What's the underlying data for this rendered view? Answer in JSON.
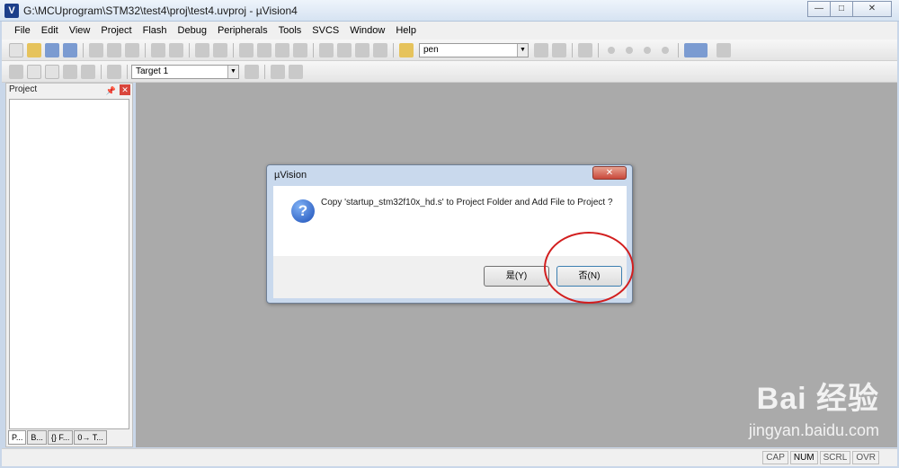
{
  "window": {
    "title": "G:\\MCUprogram\\STM32\\test4\\proj\\test4.uvproj - µVision4"
  },
  "menu": [
    "File",
    "Edit",
    "View",
    "Project",
    "Flash",
    "Debug",
    "Peripherals",
    "Tools",
    "SVCS",
    "Window",
    "Help"
  ],
  "toolbar": {
    "find_value": "pen"
  },
  "toolbar2": {
    "target": "Target 1"
  },
  "project_pane": {
    "title": "Project",
    "tabs": [
      "P...",
      "B...",
      "{} F...",
      "0→ T..."
    ]
  },
  "dialog": {
    "title": "µVision",
    "message": "Copy 'startup_stm32f10x_hd.s' to Project Folder and Add File to Project ?",
    "yes_label": "是(Y)",
    "no_label": "否(N)"
  },
  "statusbar": {
    "items": [
      "CAP",
      "NUM",
      "SCRL",
      "OVR"
    ]
  },
  "watermark": {
    "logo": "Bai  经验",
    "url": "jingyan.baidu.com"
  }
}
